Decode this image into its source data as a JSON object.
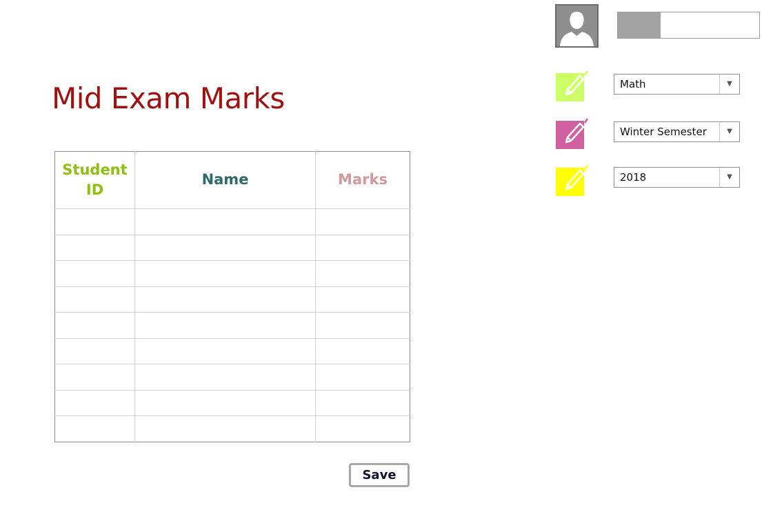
{
  "page": {
    "title": "Mid Exam Marks",
    "title_color": "#a01010"
  },
  "table": {
    "columns": [
      {
        "label": "Student ID",
        "color": "#8fbf10"
      },
      {
        "label": "Name",
        "color": "#2f6b6b"
      },
      {
        "label": "Marks",
        "color": "#d09a9a"
      }
    ],
    "empty_row_count": 9
  },
  "actions": {
    "save_label": "Save"
  },
  "user": {
    "avatar_icon": "user-silhouette-icon",
    "name_box_fill_fraction": 0.3
  },
  "filters": {
    "subject": {
      "value": "Math",
      "icon": "edit-icon",
      "icon_color": "#ccff66"
    },
    "semester": {
      "value": "Winter Semester",
      "icon": "edit-icon",
      "icon_color": "#d060a0"
    },
    "year": {
      "value": "2018",
      "icon": "edit-icon",
      "icon_color": "#ffff00"
    }
  }
}
